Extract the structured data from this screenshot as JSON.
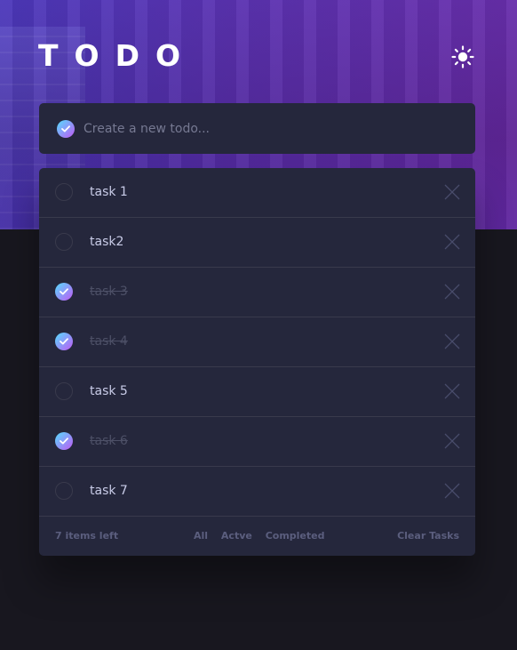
{
  "header": {
    "title": "TODO",
    "theme_toggle_icon": "sun-icon"
  },
  "new_todo": {
    "placeholder": "Create a new todo..."
  },
  "todos": [
    {
      "label": "task 1",
      "completed": false
    },
    {
      "label": "task2",
      "completed": false
    },
    {
      "label": "task 3",
      "completed": true
    },
    {
      "label": "task 4",
      "completed": true
    },
    {
      "label": "task 5",
      "completed": false
    },
    {
      "label": "task 6",
      "completed": true
    },
    {
      "label": "task 7",
      "completed": false
    }
  ],
  "footer": {
    "items_left": "7 items left",
    "filters": [
      "All",
      "Actve",
      "Completed"
    ],
    "clear_label": "Clear Tasks"
  },
  "colors": {
    "background": "#18171f",
    "card": "#25273c",
    "check_gradient_start": "#55ddff",
    "check_gradient_end": "#c058f3",
    "active_text": "#c8cbe7",
    "completed_text": "#4d5067",
    "muted_text": "#5b5e7e"
  }
}
